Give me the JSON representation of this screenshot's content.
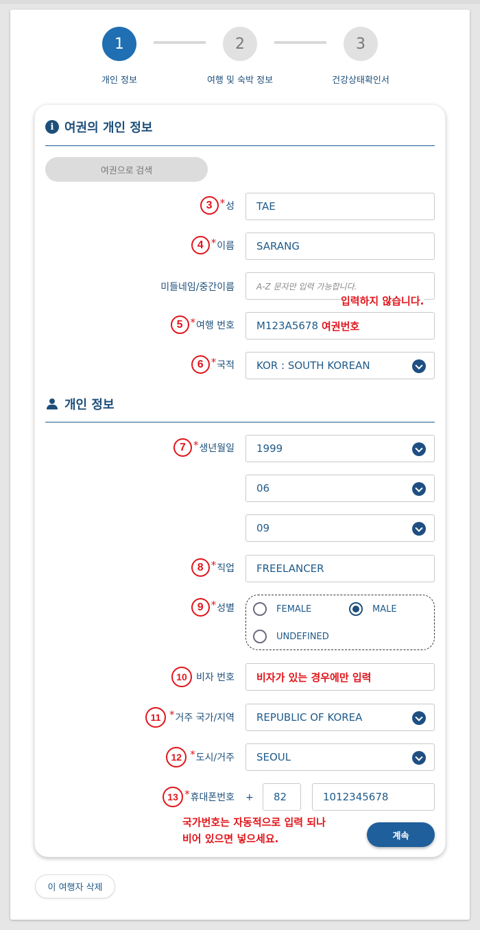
{
  "steps": [
    {
      "number": "1",
      "label": "개인 정보"
    },
    {
      "number": "2",
      "label": "여행 및 숙박 정보"
    },
    {
      "number": "3",
      "label": "건강상태확인서"
    }
  ],
  "passport_section": {
    "title": "여권의 개인 정보",
    "search_button": "여권으로 검색"
  },
  "personal_section": {
    "title": "개인 정보"
  },
  "required_mark": "*",
  "fields": {
    "surname": {
      "num": "3",
      "label": "성",
      "value": "TAE"
    },
    "given_name": {
      "num": "4",
      "label": "이름",
      "value": "SARANG"
    },
    "middle_name": {
      "label": "미들네임/중간이름",
      "placeholder": "A-Z 문자만 입력 가능합니다.",
      "note": "입력하지 않습니다."
    },
    "passport_no": {
      "num": "5",
      "label": "여행 번호",
      "value": "M123A5678",
      "note": "여권번호"
    },
    "nationality": {
      "num": "6",
      "label": "국적",
      "value": "KOR : SOUTH KOREAN"
    },
    "birth": {
      "num": "7",
      "label": "생년월일",
      "year": "1999",
      "month": "06",
      "day": "09"
    },
    "occupation": {
      "num": "8",
      "label": "직업",
      "value": "FREELANCER"
    },
    "gender": {
      "num": "9",
      "label": "성별",
      "options": [
        "FEMALE",
        "MALE",
        "UNDEFINED"
      ],
      "selected": "MALE"
    },
    "visa_no": {
      "num": "10",
      "label": "비자 번호",
      "note": "비자가 있는 경우에만 입력"
    },
    "residence_country": {
      "num": "11",
      "label": "거주 국가/지역",
      "value": "REPUBLIC OF KOREA"
    },
    "city": {
      "num": "12",
      "label": "도시/거주",
      "value": "SEOUL"
    },
    "phone": {
      "num": "13",
      "label": "휴대폰번호",
      "plus": "+",
      "country_code": "82",
      "number": "1012345678",
      "note_line1": "국가번호는 자동적으로 입력 되나",
      "note_line2": "비어 있으면 넣으세요."
    }
  },
  "buttons": {
    "continue": "계속",
    "delete_traveler": "이 여행자 삭제"
  },
  "colors": {
    "primary": "#1f6fb2",
    "annotation_red": "#e0141a"
  }
}
